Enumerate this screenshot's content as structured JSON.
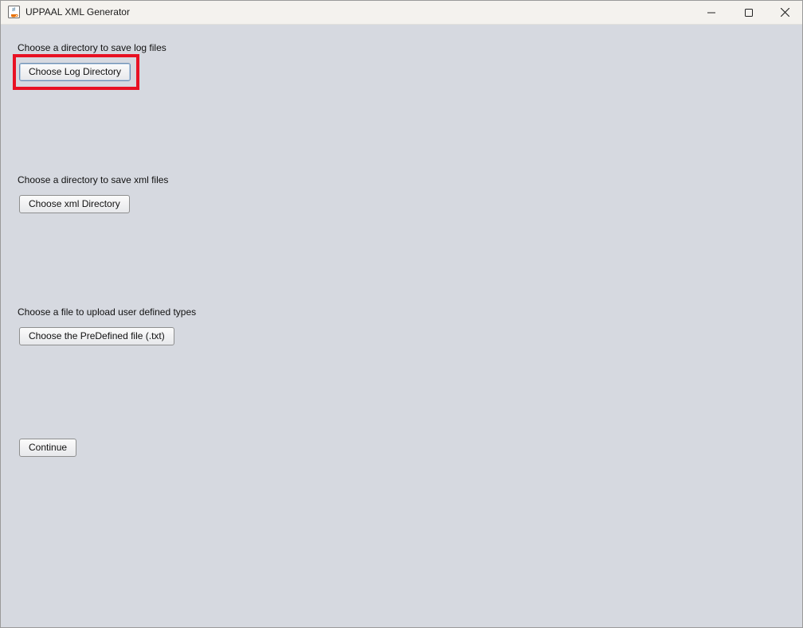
{
  "window": {
    "title": "UPPAAL XML Generator",
    "icon": "java-coffee-icon",
    "controls": {
      "minimize_icon": "minimize-icon",
      "maximize_icon": "maximize-icon",
      "close_icon": "close-icon"
    }
  },
  "sections": [
    {
      "label": "Choose a directory to save log files",
      "button": "Choose Log Directory"
    },
    {
      "label": "Choose a directory to save xml files",
      "button": "Choose xml Directory"
    },
    {
      "label": "Choose a file to upload user defined types",
      "button": "Choose the PreDefined file (.txt)"
    }
  ],
  "continue_button": "Continue",
  "colors": {
    "background": "#d6d9e0",
    "titlebar": "#f4f2ee",
    "highlight": "#e81123"
  }
}
